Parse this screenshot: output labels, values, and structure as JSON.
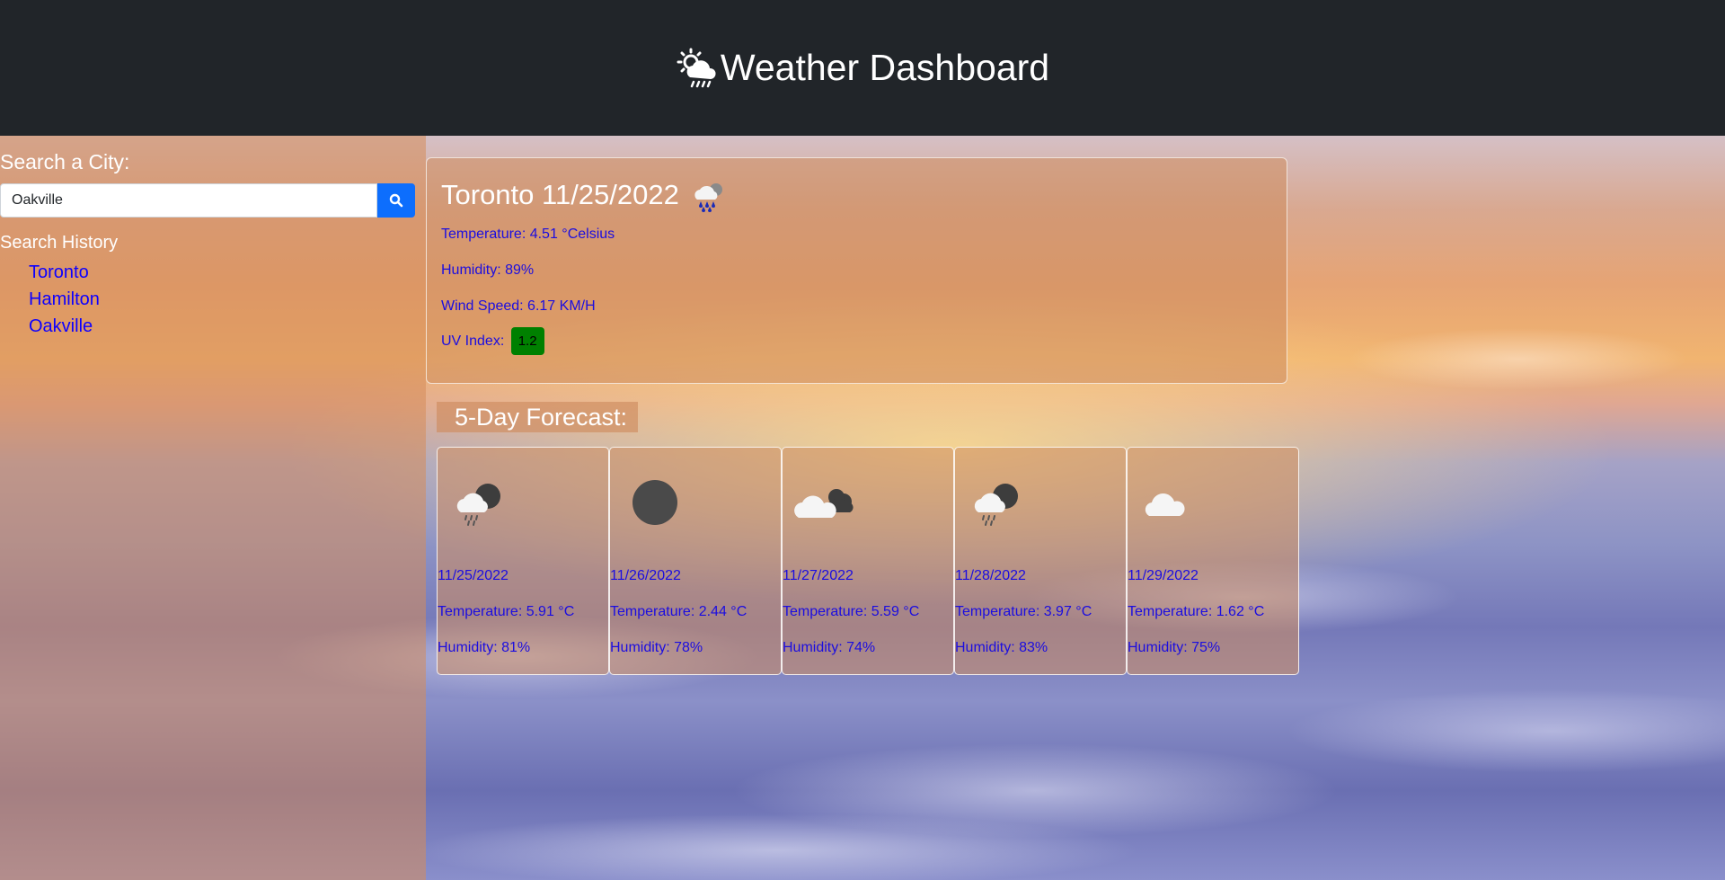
{
  "header": {
    "title": "Weather Dashboard",
    "logo_icon": "sun-cloud-rain-icon"
  },
  "sidebar": {
    "search_label": "Search a City:",
    "search_value": "Oakville",
    "search_button_icon": "search-icon",
    "history_title": "Search History",
    "history": [
      "Toronto",
      "Hamilton",
      "Oakville"
    ]
  },
  "current": {
    "title": "Toronto 11/25/2022",
    "icon": "rain-cloud-icon",
    "temperature": "Temperature: 4.51 °Celsius",
    "humidity": "Humidity: 89%",
    "wind": "Wind Speed: 6.17 KM/H",
    "uv_label": "UV Index:",
    "uv_value": "1.2",
    "uv_color": "#008000"
  },
  "forecast": {
    "title": "5-Day Forecast:",
    "days": [
      {
        "date": "11/25/2022",
        "temp": "Temperature: 5.91 °C",
        "humidity": "Humidity: 81%",
        "icon": "cloud-rain-moon-icon"
      },
      {
        "date": "11/26/2022",
        "temp": "Temperature: 2.44 °C",
        "humidity": "Humidity: 78%",
        "icon": "moon-icon"
      },
      {
        "date": "11/27/2022",
        "temp": "Temperature: 5.59 °C",
        "humidity": "Humidity: 74%",
        "icon": "broken-clouds-icon"
      },
      {
        "date": "11/28/2022",
        "temp": "Temperature: 3.97 °C",
        "humidity": "Humidity: 83%",
        "icon": "cloud-rain-moon-icon"
      },
      {
        "date": "11/29/2022",
        "temp": "Temperature: 1.62 °C",
        "humidity": "Humidity: 75%",
        "icon": "cloud-icon"
      }
    ]
  }
}
